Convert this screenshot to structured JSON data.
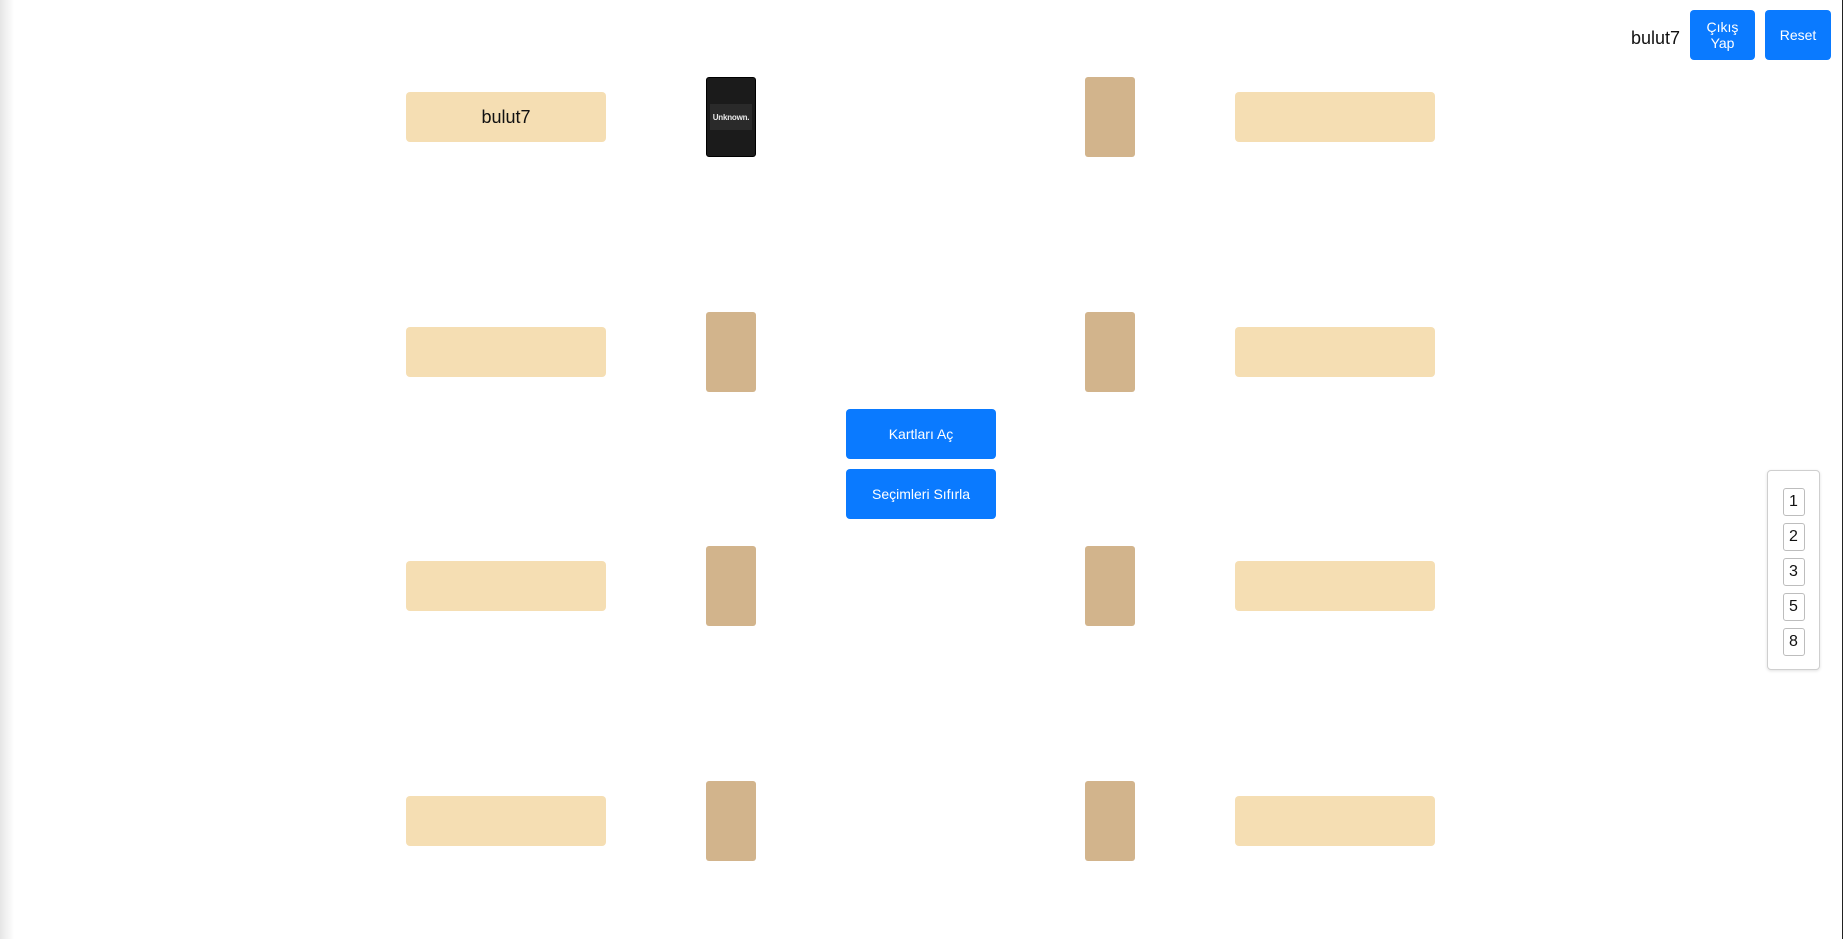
{
  "header": {
    "user_name": "bulut7",
    "logout_label": "Çıkış Yap",
    "reset_label": "Reset"
  },
  "table": {
    "left_players": [
      {
        "name": "bulut7",
        "card": "revealed",
        "card_text": "Unknown."
      },
      {
        "name": "",
        "card": "empty"
      },
      {
        "name": "",
        "card": "empty"
      },
      {
        "name": "",
        "card": "empty"
      }
    ],
    "right_players": [
      {
        "name": "",
        "card": "empty"
      },
      {
        "name": "",
        "card": "empty"
      },
      {
        "name": "",
        "card": "empty"
      },
      {
        "name": "",
        "card": "empty"
      }
    ],
    "open_cards_label": "Kartları Aç",
    "reset_selection_label": "Seçimleri Sıfırla"
  },
  "vote_panel": {
    "options": [
      "1",
      "2",
      "3",
      "5",
      "8"
    ]
  },
  "colors": {
    "primary_button": "#0a7aff",
    "name_slot": "#f5deb3",
    "card_back": "#d2b48c",
    "card_revealed": "#1b1b1b"
  }
}
